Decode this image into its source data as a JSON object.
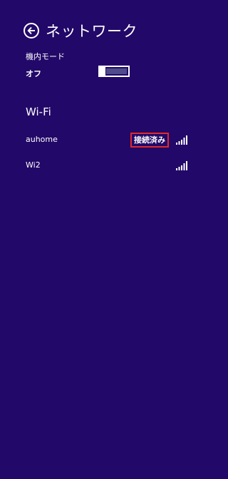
{
  "header": {
    "title": "ネットワーク",
    "back_icon": "back-arrow-icon"
  },
  "airplane_mode": {
    "label": "機内モード",
    "state_label": "オフ",
    "enabled": false
  },
  "wifi": {
    "heading": "Wi-Fi",
    "networks": [
      {
        "name": "auhome",
        "status": "接続済み",
        "signal_bars": 5,
        "signal_icon": "wifi-signal-icon"
      },
      {
        "name": "Wi2",
        "status": "",
        "signal_bars": 5,
        "signal_icon": "wifi-signal-icon"
      }
    ]
  },
  "colors": {
    "background": "#220868",
    "foreground": "#ffffff",
    "highlight_border": "#e02a2a",
    "toggle_track": "#4e4c8a"
  }
}
